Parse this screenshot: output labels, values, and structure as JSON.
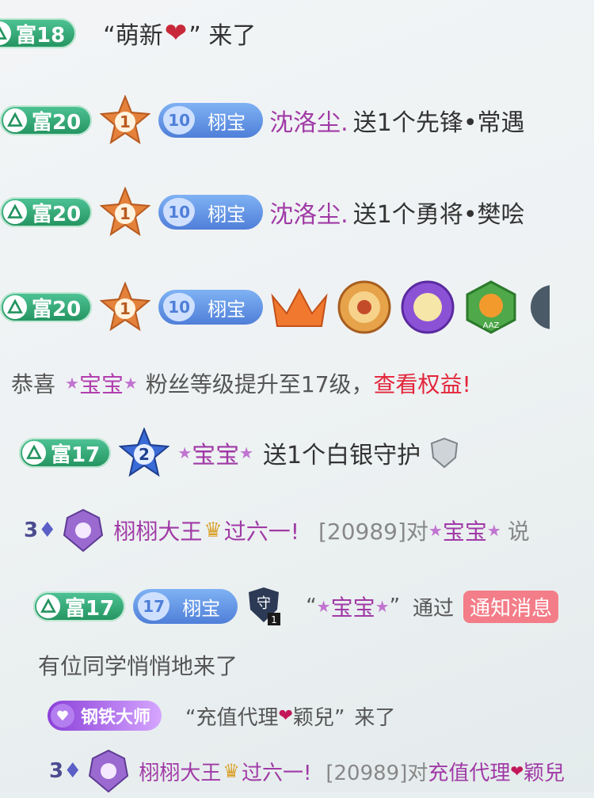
{
  "rows": [
    {
      "wealth": "富18",
      "text_a": "“萌新",
      "text_b": "” 来了"
    },
    {
      "wealth": "富20",
      "rank": "1",
      "fan_level": "10",
      "fan_name": "栩宝",
      "user": "沈洛尘.",
      "msg": "送1个先锋•常遇"
    },
    {
      "wealth": "富20",
      "rank": "1",
      "fan_level": "10",
      "fan_name": "栩宝",
      "user": "沈洛尘.",
      "msg": "送1个勇将•樊哙"
    },
    {
      "wealth": "富20",
      "rank": "1",
      "fan_level": "10",
      "fan_name": "栩宝",
      "medal4": "AAZ"
    }
  ],
  "levelup": {
    "prefix": "恭喜",
    "user": "宝宝",
    "mid": "粉丝等级提升至17级，",
    "link": "查看权益!"
  },
  "gift_row": {
    "wealth": "富17",
    "rank": "2",
    "user": "宝宝",
    "msg": "送1个白银守护"
  },
  "chat_row_1": {
    "badge": "3",
    "user": "栩栩大王",
    "msg": "过六一!",
    "room": "[20989]对",
    "target": "宝宝",
    "verb": "说"
  },
  "join_row": {
    "wealth": "富17",
    "fan_level": "17",
    "fan_name": "栩宝",
    "guard_level": "1",
    "guard_char": "守",
    "user": "“",
    "user_name": "宝宝",
    "user_close": "”",
    "pass": "通过",
    "tag": "通知消息"
  },
  "anon_row": {
    "text": "有位同学悄悄地来了"
  },
  "vip_row": {
    "vip": "钢铁大师",
    "text": "“充值代理",
    "heart": "❤",
    "name": "颖兒”",
    "come": "来了"
  },
  "chat_row_2": {
    "badge": "3",
    "user": "栩栩大王",
    "msg": "过六一!",
    "room": "[20989]对",
    "target": "充值代理",
    "heart": "❤",
    "name2": "颖兒"
  },
  "colors": {
    "wealth": "#23935f",
    "fan": "#4f7fd8",
    "user": "#a03aa6",
    "alert": "#e3253a"
  },
  "icons": [
    "leaf-icon",
    "rank-star-icon",
    "heart-icon",
    "crown-icon",
    "medal-icon",
    "shield-icon",
    "crest-icon"
  ]
}
